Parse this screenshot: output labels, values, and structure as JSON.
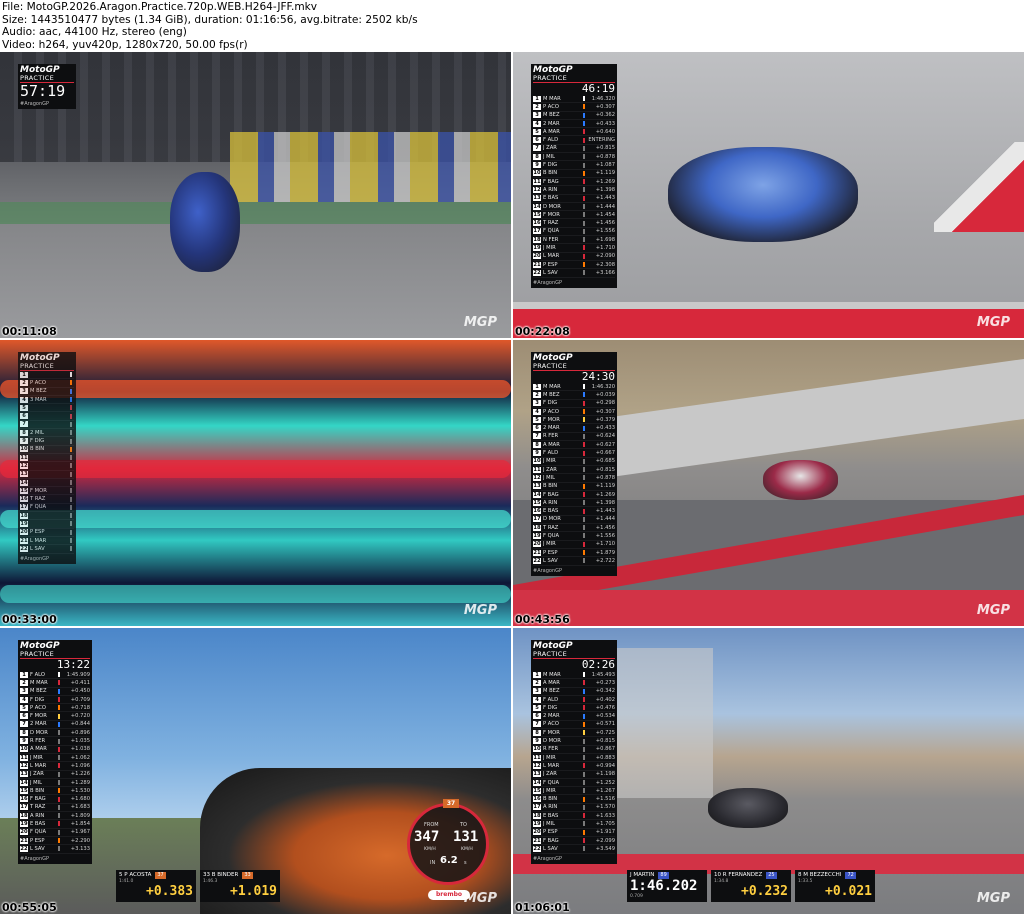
{
  "meta": {
    "file": "File: MotoGP.2026.Aragon.Practice.720p.WEB.H264-JFF.mkv",
    "size": "Size: 1443510477 bytes (1.34 GiB), duration: 01:16:56, avg.bitrate: 2502 kb/s",
    "audio": "Audio: aac, 44100 Hz, stereo (eng)",
    "video": "Video: h264, yuv420p, 1280x720, 50.00 fps(r)"
  },
  "colors": {
    "accent_red": "#d7283b",
    "panel": "#0d0e10",
    "gap_yellow": "#ffcf40"
  },
  "brand": {
    "logo": "MotoGP",
    "session": "PRACTICE",
    "tag": "#AragonGP",
    "watermark": "MGP"
  },
  "tiles": [
    {
      "timestamp": "00:11:08",
      "clock": "57:19",
      "rows": []
    },
    {
      "timestamp": "00:22:08",
      "clock": "46:19",
      "rows": [
        {
          "pos": "1",
          "name": "M MAR",
          "gap": "1:46.320",
          "bar": "#ffffff"
        },
        {
          "pos": "2",
          "name": "P ACO",
          "gap": "+0.307",
          "bar": "#ff7a00"
        },
        {
          "pos": "3",
          "name": "M BEZ",
          "gap": "+0.362",
          "bar": "#2b7bff"
        },
        {
          "pos": "4",
          "name": "2 MAR",
          "gap": "+0.433",
          "bar": "#2b7bff"
        },
        {
          "pos": "5",
          "name": "A MAR",
          "gap": "+0.640",
          "bar": "#d7283b"
        },
        {
          "pos": "6",
          "name": "F ALD",
          "gap": "ENTERING",
          "bar": "#d7283b"
        },
        {
          "pos": "7",
          "name": "J ZAR",
          "gap": "+0.815",
          "bar": "#7a7a7a"
        },
        {
          "pos": "8",
          "name": "J MIL",
          "gap": "+0.878",
          "bar": "#7a7a7a"
        },
        {
          "pos": "9",
          "name": "F DIG",
          "gap": "+1.087",
          "bar": "#7a7a7a"
        },
        {
          "pos": "10",
          "name": "B BIN",
          "gap": "+1.119",
          "bar": "#ff7a00"
        },
        {
          "pos": "11",
          "name": "F BAG",
          "gap": "+1.269",
          "bar": "#d7283b"
        },
        {
          "pos": "12",
          "name": "A RIN",
          "gap": "+1.398",
          "bar": "#7a7a7a"
        },
        {
          "pos": "13",
          "name": "E BAS",
          "gap": "+1.443",
          "bar": "#d7283b"
        },
        {
          "pos": "14",
          "name": "D MOR",
          "gap": "+1.444",
          "bar": "#7a7a7a"
        },
        {
          "pos": "15",
          "name": "F MOR",
          "gap": "+1.454",
          "bar": "#7a7a7a"
        },
        {
          "pos": "16",
          "name": "T RAZ",
          "gap": "+1.456",
          "bar": "#7a7a7a"
        },
        {
          "pos": "17",
          "name": "F QUA",
          "gap": "+1.556",
          "bar": "#7a7a7a"
        },
        {
          "pos": "18",
          "name": "N FER",
          "gap": "+1.698",
          "bar": "#7a7a7a"
        },
        {
          "pos": "19",
          "name": "J MIR",
          "gap": "+1.710",
          "bar": "#d7283b"
        },
        {
          "pos": "20",
          "name": "L MAR",
          "gap": "+2.090",
          "bar": "#d7283b"
        },
        {
          "pos": "21",
          "name": "P ESP",
          "gap": "+2.308",
          "bar": "#ff7a00"
        },
        {
          "pos": "22",
          "name": "L SAV",
          "gap": "+3.166",
          "bar": "#7a7a7a"
        }
      ]
    },
    {
      "timestamp": "00:33:00",
      "clock": "",
      "rows": [
        {
          "pos": "1",
          "name": "",
          "bar": "#ffffff"
        },
        {
          "pos": "2",
          "name": "P ACO",
          "bar": "#ff7a00"
        },
        {
          "pos": "3",
          "name": "M BEZ",
          "bar": "#2b7bff"
        },
        {
          "pos": "4",
          "name": "3 MAR",
          "bar": "#2b7bff"
        },
        {
          "pos": "5",
          "name": "",
          "bar": "#d7283b"
        },
        {
          "pos": "6",
          "name": "",
          "bar": "#d7283b"
        },
        {
          "pos": "7",
          "name": "",
          "bar": "#7a7a7a"
        },
        {
          "pos": "8",
          "name": "2 MIL",
          "bar": "#7a7a7a"
        },
        {
          "pos": "9",
          "name": "F DIG",
          "bar": "#7a7a7a"
        },
        {
          "pos": "10",
          "name": "B BIN",
          "bar": "#ff7a00"
        },
        {
          "pos": "11",
          "name": "",
          "bar": "#7a7a7a"
        },
        {
          "pos": "12",
          "name": "",
          "bar": "#7a7a7a"
        },
        {
          "pos": "13",
          "name": "",
          "bar": "#7a7a7a"
        },
        {
          "pos": "14",
          "name": "",
          "bar": "#7a7a7a"
        },
        {
          "pos": "15",
          "name": "F MOR",
          "bar": "#7a7a7a"
        },
        {
          "pos": "16",
          "name": "T RAZ",
          "bar": "#7a7a7a"
        },
        {
          "pos": "17",
          "name": "F QUA",
          "bar": "#7a7a7a"
        },
        {
          "pos": "18",
          "name": "",
          "bar": "#7a7a7a"
        },
        {
          "pos": "19",
          "name": "",
          "bar": "#7a7a7a"
        },
        {
          "pos": "20",
          "name": "P ESP",
          "bar": "#7a7a7a"
        },
        {
          "pos": "21",
          "name": "L MAR",
          "bar": "#7a7a7a"
        },
        {
          "pos": "22",
          "name": "L SAV",
          "bar": "#7a7a7a"
        }
      ]
    },
    {
      "timestamp": "00:43:56",
      "clock": "24:30",
      "rows": [
        {
          "pos": "1",
          "name": "M MAR",
          "gap": "1:46.320",
          "bar": "#ffffff"
        },
        {
          "pos": "2",
          "name": "M BEZ",
          "gap": "+0.039",
          "bar": "#2b7bff"
        },
        {
          "pos": "3",
          "name": "F DIG",
          "gap": "+0.298",
          "bar": "#d7283b"
        },
        {
          "pos": "4",
          "name": "P ACO",
          "gap": "+0.307",
          "bar": "#ff7a00"
        },
        {
          "pos": "5",
          "name": "F MOR",
          "gap": "+0.379",
          "bar": "#ffcf40"
        },
        {
          "pos": "6",
          "name": "2 MAR",
          "gap": "+0.433",
          "bar": "#2b7bff"
        },
        {
          "pos": "7",
          "name": "R FER",
          "gap": "+0.624",
          "bar": "#7a7a7a"
        },
        {
          "pos": "8",
          "name": "A MAR",
          "gap": "+0.627",
          "bar": "#d7283b"
        },
        {
          "pos": "9",
          "name": "F ALD",
          "gap": "+0.667",
          "bar": "#d7283b"
        },
        {
          "pos": "10",
          "name": "J MIR",
          "gap": "+0.685",
          "bar": "#7a7a7a"
        },
        {
          "pos": "11",
          "name": "J ZAR",
          "gap": "+0.815",
          "bar": "#7a7a7a"
        },
        {
          "pos": "12",
          "name": "J MIL",
          "gap": "+0.878",
          "bar": "#7a7a7a"
        },
        {
          "pos": "13",
          "name": "B BIN",
          "gap": "+1.119",
          "bar": "#ff7a00"
        },
        {
          "pos": "14",
          "name": "F BAG",
          "gap": "+1.269",
          "bar": "#d7283b"
        },
        {
          "pos": "15",
          "name": "A RIN",
          "gap": "+1.398",
          "bar": "#7a7a7a"
        },
        {
          "pos": "16",
          "name": "E BAS",
          "gap": "+1.443",
          "bar": "#d7283b"
        },
        {
          "pos": "17",
          "name": "D MOR",
          "gap": "+1.444",
          "bar": "#7a7a7a"
        },
        {
          "pos": "18",
          "name": "T RAZ",
          "gap": "+1.456",
          "bar": "#7a7a7a"
        },
        {
          "pos": "19",
          "name": "F QUA",
          "gap": "+1.556",
          "bar": "#7a7a7a"
        },
        {
          "pos": "20",
          "name": "J MIR",
          "gap": "+1.710",
          "bar": "#d7283b"
        },
        {
          "pos": "21",
          "name": "P ESP",
          "gap": "+1.879",
          "bar": "#ff7a00"
        },
        {
          "pos": "22",
          "name": "L SAV",
          "gap": "+2.722",
          "bar": "#7a7a7a"
        }
      ]
    },
    {
      "timestamp": "00:55:05",
      "clock": "13:22",
      "rows": [
        {
          "pos": "1",
          "name": "F ALO",
          "gap": "1:45.909",
          "bar": "#ffffff"
        },
        {
          "pos": "2",
          "name": "M MAR",
          "gap": "+0.411",
          "bar": "#d7283b"
        },
        {
          "pos": "3",
          "name": "M BEZ",
          "gap": "+0.450",
          "bar": "#2b7bff"
        },
        {
          "pos": "4",
          "name": "F DIG",
          "gap": "+0.709",
          "bar": "#d7283b"
        },
        {
          "pos": "5",
          "name": "P ACO",
          "gap": "+0.718",
          "bar": "#ff7a00"
        },
        {
          "pos": "6",
          "name": "F MOR",
          "gap": "+0.720",
          "bar": "#ffcf40"
        },
        {
          "pos": "7",
          "name": "2 MAR",
          "gap": "+0.844",
          "bar": "#2b7bff"
        },
        {
          "pos": "8",
          "name": "D MOR",
          "gap": "+0.896",
          "bar": "#7a7a7a"
        },
        {
          "pos": "9",
          "name": "R FER",
          "gap": "+1.035",
          "bar": "#7a7a7a"
        },
        {
          "pos": "10",
          "name": "A MAR",
          "gap": "+1.038",
          "bar": "#d7283b"
        },
        {
          "pos": "11",
          "name": "J MIR",
          "gap": "+1.062",
          "bar": "#7a7a7a"
        },
        {
          "pos": "12",
          "name": "L MAR",
          "gap": "+1.096",
          "bar": "#d7283b"
        },
        {
          "pos": "13",
          "name": "J ZAR",
          "gap": "+1.226",
          "bar": "#7a7a7a"
        },
        {
          "pos": "14",
          "name": "J MIL",
          "gap": "+1.289",
          "bar": "#7a7a7a"
        },
        {
          "pos": "15",
          "name": "B BIN",
          "gap": "+1.530",
          "bar": "#ff7a00"
        },
        {
          "pos": "16",
          "name": "F BAG",
          "gap": "+1.680",
          "bar": "#d7283b"
        },
        {
          "pos": "17",
          "name": "T RAZ",
          "gap": "+1.683",
          "bar": "#7a7a7a"
        },
        {
          "pos": "18",
          "name": "A RIN",
          "gap": "+1.809",
          "bar": "#7a7a7a"
        },
        {
          "pos": "19",
          "name": "E BAS",
          "gap": "+1.854",
          "bar": "#d7283b"
        },
        {
          "pos": "20",
          "name": "F QUA",
          "gap": "+1.967",
          "bar": "#7a7a7a"
        },
        {
          "pos": "21",
          "name": "P ESP",
          "gap": "+2.290",
          "bar": "#ff7a00"
        },
        {
          "pos": "22",
          "name": "L SAV",
          "gap": "+3.133",
          "bar": "#7a7a7a"
        }
      ],
      "gauge": {
        "from_label": "FROM",
        "from_value": "347",
        "from_unit": "KM/H",
        "to_label": "TO",
        "to_value": "131",
        "to_unit": "KM/H",
        "in_label": "IN",
        "seconds": "6.2",
        "seconds_unit": "s",
        "gear": "37",
        "sponsor": "brembo"
      },
      "cards": [
        {
          "name": "5 P ACOSTA",
          "num": "37",
          "sub": "1:41.0",
          "gap": "+0.383"
        },
        {
          "name": "33 B BINDER",
          "num": "33",
          "sub": "1:46.3",
          "gap": "+1.019"
        }
      ]
    },
    {
      "timestamp": "01:06:01",
      "clock": "02:26",
      "rows": [
        {
          "pos": "1",
          "name": "M MAR",
          "gap": "1:45.493",
          "bar": "#ffffff"
        },
        {
          "pos": "2",
          "name": "A MAR",
          "gap": "+0.273",
          "bar": "#d7283b"
        },
        {
          "pos": "3",
          "name": "M BEZ",
          "gap": "+0.342",
          "bar": "#2b7bff"
        },
        {
          "pos": "4",
          "name": "F ALD",
          "gap": "+0.402",
          "bar": "#d7283b"
        },
        {
          "pos": "5",
          "name": "F DIG",
          "gap": "+0.476",
          "bar": "#d7283b"
        },
        {
          "pos": "6",
          "name": "2 MAR",
          "gap": "+0.534",
          "bar": "#2b7bff"
        },
        {
          "pos": "7",
          "name": "P ACO",
          "gap": "+0.571",
          "bar": "#ff7a00"
        },
        {
          "pos": "8",
          "name": "F MOR",
          "gap": "+0.725",
          "bar": "#ffcf40"
        },
        {
          "pos": "9",
          "name": "D MOR",
          "gap": "+0.815",
          "bar": "#7a7a7a"
        },
        {
          "pos": "10",
          "name": "R FER",
          "gap": "+0.867",
          "bar": "#7a7a7a"
        },
        {
          "pos": "11",
          "name": "J MIR",
          "gap": "+0.883",
          "bar": "#7a7a7a"
        },
        {
          "pos": "12",
          "name": "L MAR",
          "gap": "+0.994",
          "bar": "#d7283b"
        },
        {
          "pos": "13",
          "name": "J ZAR",
          "gap": "+1.198",
          "bar": "#7a7a7a"
        },
        {
          "pos": "14",
          "name": "F QUA",
          "gap": "+1.252",
          "bar": "#7a7a7a"
        },
        {
          "pos": "15",
          "name": "J MIR",
          "gap": "+1.267",
          "bar": "#7a7a7a"
        },
        {
          "pos": "16",
          "name": "B BIN",
          "gap": "+1.516",
          "bar": "#ff7a00"
        },
        {
          "pos": "17",
          "name": "A RIN",
          "gap": "+1.570",
          "bar": "#7a7a7a"
        },
        {
          "pos": "18",
          "name": "E BAS",
          "gap": "+1.633",
          "bar": "#d7283b"
        },
        {
          "pos": "19",
          "name": "J MIL",
          "gap": "+1.705",
          "bar": "#7a7a7a"
        },
        {
          "pos": "20",
          "name": "P ESP",
          "gap": "+1.917",
          "bar": "#ff7a00"
        },
        {
          "pos": "21",
          "name": "F BAG",
          "gap": "+2.099",
          "bar": "#d7283b"
        },
        {
          "pos": "22",
          "name": "L SAV",
          "gap": "+3.549",
          "bar": "#7a7a7a"
        }
      ],
      "cards": [
        {
          "name": "J MARTIN",
          "num": "89",
          "sub": "0.709",
          "gap": "1:46.202"
        },
        {
          "name": "10 R FERNANDEZ",
          "num": "25",
          "sub": "1:34.8",
          "gap": "+0.232"
        },
        {
          "name": "8 M BEZZECCHI",
          "num": "72",
          "sub": "1:33.5",
          "gap": "+0.021"
        }
      ]
    }
  ]
}
